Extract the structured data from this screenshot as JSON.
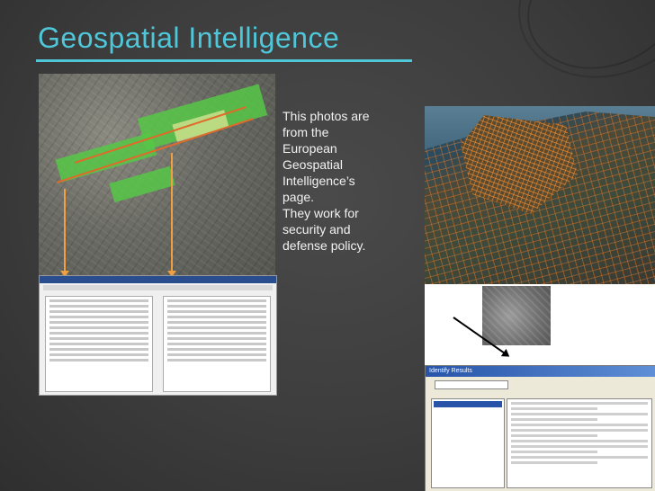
{
  "slide": {
    "title": "Geospatial Intelligence",
    "body_text": "This photos are\nfrom the\nEuropean\nGeospatial\nIntelligence’s\npage.\nThey work for\nsecurity and\ndefense policy.",
    "accent_color": "#4fc7d9",
    "background_color": "#3d3d3d"
  },
  "images": {
    "left": "aerial-photo-with-identify-results",
    "right_top": "satellite-city-map",
    "right_bottom": "identify-results-dialog",
    "right_bottom_dialog_title": "Identify Results"
  }
}
